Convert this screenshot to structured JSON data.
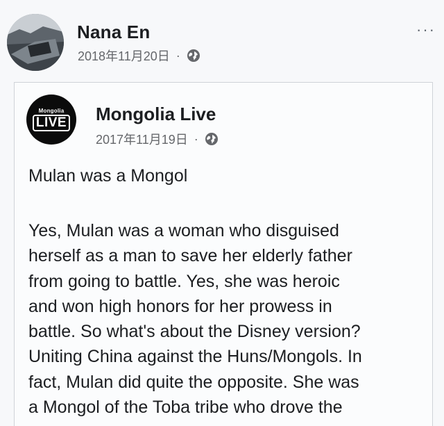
{
  "post": {
    "author": "Nana En",
    "date": "2018年11月20日",
    "separator": "·",
    "privacy_icon": "globe-icon",
    "more_icon": "more-options-icon",
    "more_label": "···"
  },
  "shared": {
    "page_name": "Mongolia Live",
    "logo_small_text": "Mongolia",
    "logo_big_text": "LIVE",
    "date": "2017年11月19日",
    "separator": "·",
    "privacy_icon": "globe-icon",
    "title": "Mulan was a Mongol",
    "body_lines": [
      "Yes, Mulan was a woman who disguised",
      "herself as a man to save her elderly father",
      "from going to battle. Yes, she was heroic",
      "and won high honors for her prowess in",
      "battle. So what's about the Disney version?",
      "Uniting China against the Huns/Mongols. In",
      "fact, Mulan did quite the opposite. She was",
      "a Mongol of the Toba tribe who drove the"
    ]
  }
}
